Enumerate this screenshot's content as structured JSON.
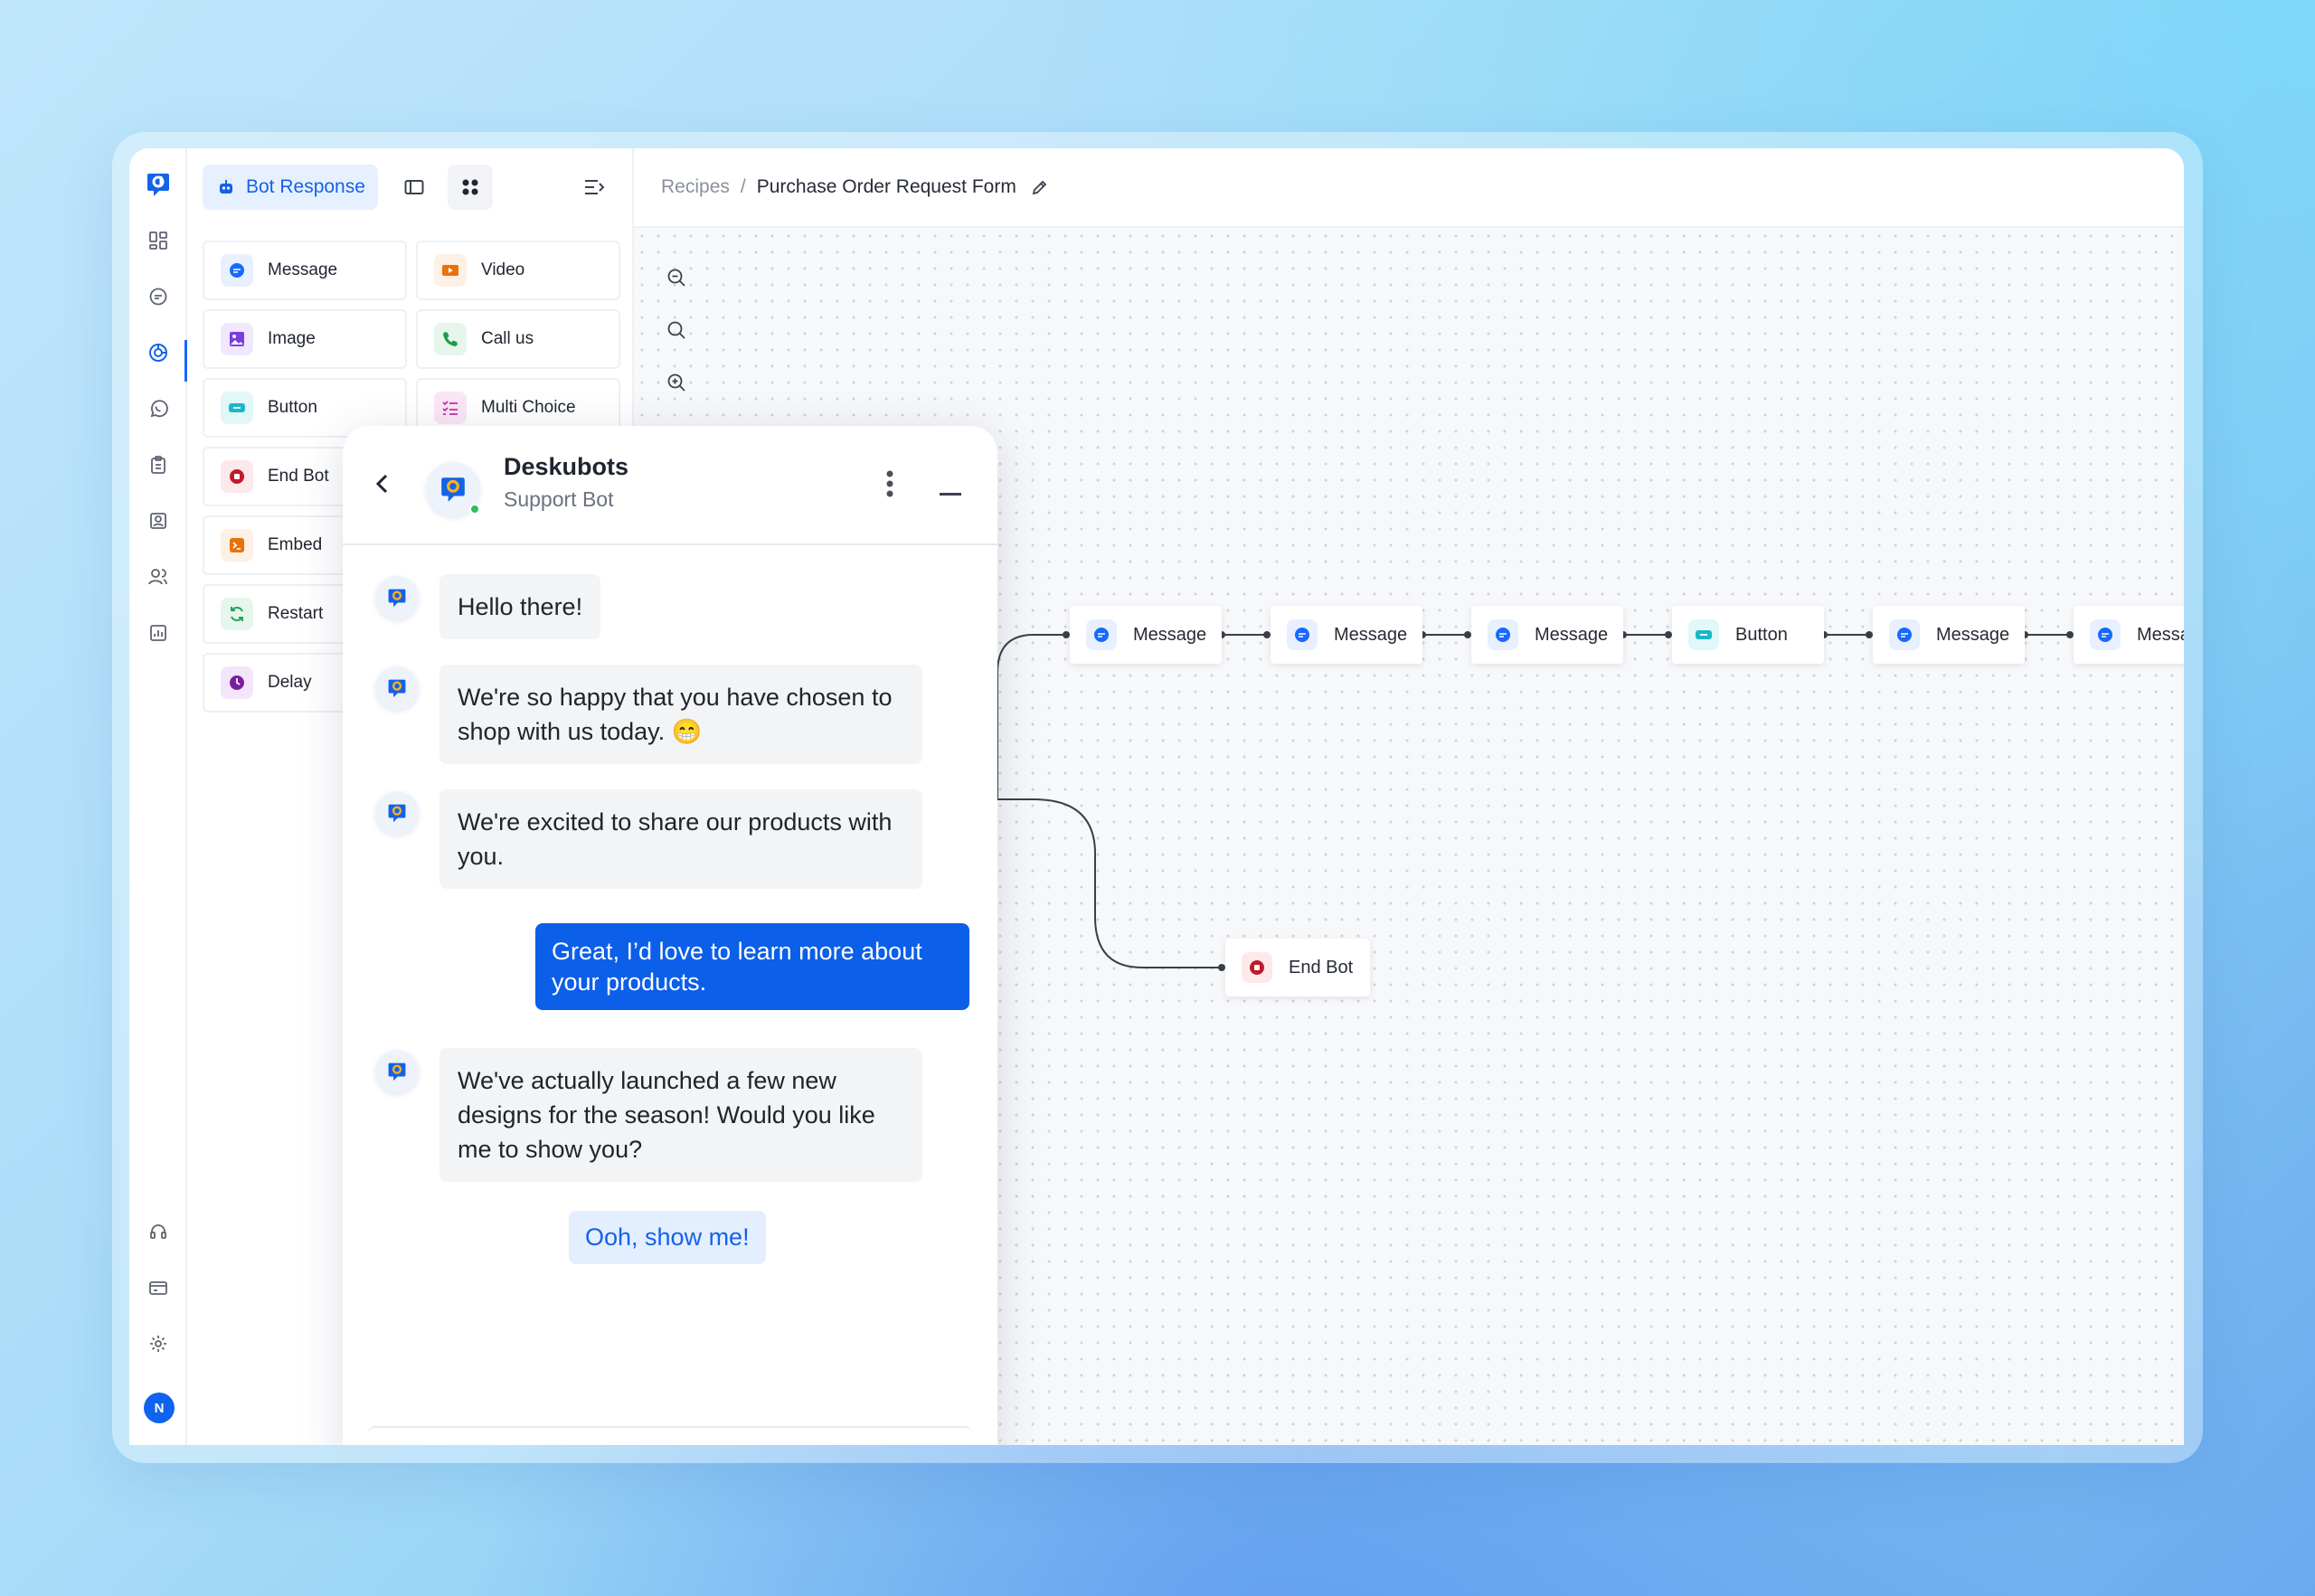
{
  "colors": {
    "accent": "#1462e8",
    "message_icon": "#1769ff",
    "button_icon": "#18b8c8",
    "end_bot_icon": "#c0192e",
    "video_icon": "#e8720c",
    "call_icon": "#1e9c4a",
    "multi_choice_icon": "#c12fae",
    "embed_icon": "#e8720c",
    "restart_icon": "#22a35a",
    "delay_icon": "#7a1fa2",
    "online_dot": "#2bbf5a"
  },
  "panel": {
    "active_tab_label": "Bot Response",
    "blocks": [
      {
        "label": "Message",
        "icon": "message-icon"
      },
      {
        "label": "Video",
        "icon": "video-icon"
      },
      {
        "label": "Image",
        "icon": "image-icon"
      },
      {
        "label": "Call us",
        "icon": "phone-icon"
      },
      {
        "label": "Button",
        "icon": "button-icon"
      },
      {
        "label": "Multi Choice",
        "icon": "checklist-icon"
      },
      {
        "label": "End Bot",
        "icon": "stop-icon"
      },
      {
        "label": "Embed",
        "icon": "terminal-icon"
      },
      {
        "label": "Restart",
        "icon": "refresh-icon"
      },
      {
        "label": "Delay",
        "icon": "clock-icon"
      }
    ]
  },
  "breadcrumb": {
    "root": "Recipes",
    "separator": "/",
    "current": "Purchase Order Request Form"
  },
  "flow": {
    "nodes": [
      {
        "label": "Message",
        "icon": "message-icon"
      },
      {
        "label": "Message",
        "icon": "message-icon"
      },
      {
        "label": "Message",
        "icon": "message-icon"
      },
      {
        "label": "Button",
        "icon": "button-icon"
      },
      {
        "label": "Message",
        "icon": "message-icon"
      },
      {
        "label": "Message",
        "icon": "message-icon"
      }
    ],
    "end_node": {
      "label": "End Bot",
      "icon": "stop-icon"
    }
  },
  "chat": {
    "bot_name": "Deskubots",
    "bot_subtitle": "Support Bot",
    "messages": [
      {
        "from": "bot",
        "text": "Hello there!"
      },
      {
        "from": "bot",
        "text": "We're so happy that you have chosen to shop with us today. 😁"
      },
      {
        "from": "bot",
        "text": "We're excited to share our products with you."
      },
      {
        "from": "user",
        "text": "Great, I’d love to learn more about your products."
      },
      {
        "from": "bot",
        "text": "We've actually launched a few new designs for the season! Would you like me to show you?"
      }
    ],
    "quick_reply": "Ooh, show me!"
  },
  "user": {
    "avatar_initial": "N"
  }
}
